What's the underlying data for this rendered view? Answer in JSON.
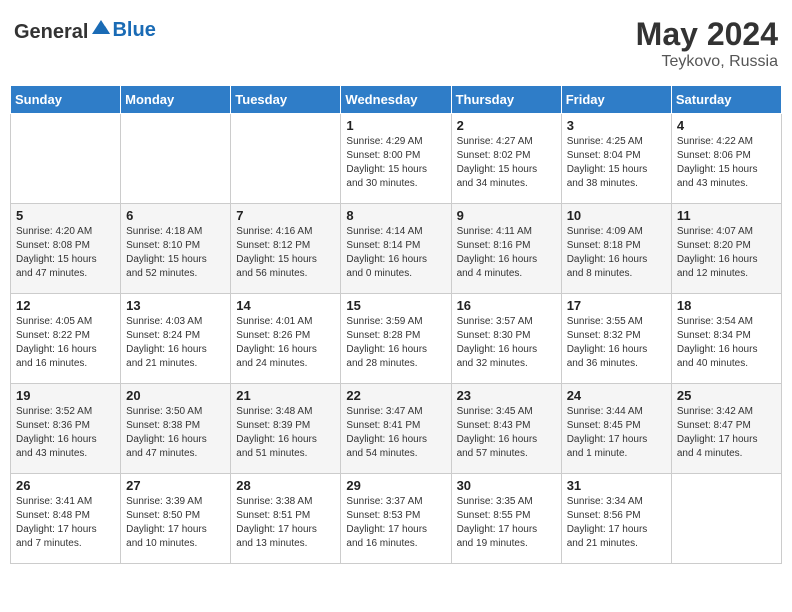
{
  "header": {
    "logo_general": "General",
    "logo_blue": "Blue",
    "month_year": "May 2024",
    "location": "Teykovo, Russia"
  },
  "days_of_week": [
    "Sunday",
    "Monday",
    "Tuesday",
    "Wednesday",
    "Thursday",
    "Friday",
    "Saturday"
  ],
  "weeks": [
    [
      {
        "day": "",
        "info": ""
      },
      {
        "day": "",
        "info": ""
      },
      {
        "day": "",
        "info": ""
      },
      {
        "day": "1",
        "info": "Sunrise: 4:29 AM\nSunset: 8:00 PM\nDaylight: 15 hours\nand 30 minutes."
      },
      {
        "day": "2",
        "info": "Sunrise: 4:27 AM\nSunset: 8:02 PM\nDaylight: 15 hours\nand 34 minutes."
      },
      {
        "day": "3",
        "info": "Sunrise: 4:25 AM\nSunset: 8:04 PM\nDaylight: 15 hours\nand 38 minutes."
      },
      {
        "day": "4",
        "info": "Sunrise: 4:22 AM\nSunset: 8:06 PM\nDaylight: 15 hours\nand 43 minutes."
      }
    ],
    [
      {
        "day": "5",
        "info": "Sunrise: 4:20 AM\nSunset: 8:08 PM\nDaylight: 15 hours\nand 47 minutes."
      },
      {
        "day": "6",
        "info": "Sunrise: 4:18 AM\nSunset: 8:10 PM\nDaylight: 15 hours\nand 52 minutes."
      },
      {
        "day": "7",
        "info": "Sunrise: 4:16 AM\nSunset: 8:12 PM\nDaylight: 15 hours\nand 56 minutes."
      },
      {
        "day": "8",
        "info": "Sunrise: 4:14 AM\nSunset: 8:14 PM\nDaylight: 16 hours\nand 0 minutes."
      },
      {
        "day": "9",
        "info": "Sunrise: 4:11 AM\nSunset: 8:16 PM\nDaylight: 16 hours\nand 4 minutes."
      },
      {
        "day": "10",
        "info": "Sunrise: 4:09 AM\nSunset: 8:18 PM\nDaylight: 16 hours\nand 8 minutes."
      },
      {
        "day": "11",
        "info": "Sunrise: 4:07 AM\nSunset: 8:20 PM\nDaylight: 16 hours\nand 12 minutes."
      }
    ],
    [
      {
        "day": "12",
        "info": "Sunrise: 4:05 AM\nSunset: 8:22 PM\nDaylight: 16 hours\nand 16 minutes."
      },
      {
        "day": "13",
        "info": "Sunrise: 4:03 AM\nSunset: 8:24 PM\nDaylight: 16 hours\nand 21 minutes."
      },
      {
        "day": "14",
        "info": "Sunrise: 4:01 AM\nSunset: 8:26 PM\nDaylight: 16 hours\nand 24 minutes."
      },
      {
        "day": "15",
        "info": "Sunrise: 3:59 AM\nSunset: 8:28 PM\nDaylight: 16 hours\nand 28 minutes."
      },
      {
        "day": "16",
        "info": "Sunrise: 3:57 AM\nSunset: 8:30 PM\nDaylight: 16 hours\nand 32 minutes."
      },
      {
        "day": "17",
        "info": "Sunrise: 3:55 AM\nSunset: 8:32 PM\nDaylight: 16 hours\nand 36 minutes."
      },
      {
        "day": "18",
        "info": "Sunrise: 3:54 AM\nSunset: 8:34 PM\nDaylight: 16 hours\nand 40 minutes."
      }
    ],
    [
      {
        "day": "19",
        "info": "Sunrise: 3:52 AM\nSunset: 8:36 PM\nDaylight: 16 hours\nand 43 minutes."
      },
      {
        "day": "20",
        "info": "Sunrise: 3:50 AM\nSunset: 8:38 PM\nDaylight: 16 hours\nand 47 minutes."
      },
      {
        "day": "21",
        "info": "Sunrise: 3:48 AM\nSunset: 8:39 PM\nDaylight: 16 hours\nand 51 minutes."
      },
      {
        "day": "22",
        "info": "Sunrise: 3:47 AM\nSunset: 8:41 PM\nDaylight: 16 hours\nand 54 minutes."
      },
      {
        "day": "23",
        "info": "Sunrise: 3:45 AM\nSunset: 8:43 PM\nDaylight: 16 hours\nand 57 minutes."
      },
      {
        "day": "24",
        "info": "Sunrise: 3:44 AM\nSunset: 8:45 PM\nDaylight: 17 hours\nand 1 minute."
      },
      {
        "day": "25",
        "info": "Sunrise: 3:42 AM\nSunset: 8:47 PM\nDaylight: 17 hours\nand 4 minutes."
      }
    ],
    [
      {
        "day": "26",
        "info": "Sunrise: 3:41 AM\nSunset: 8:48 PM\nDaylight: 17 hours\nand 7 minutes."
      },
      {
        "day": "27",
        "info": "Sunrise: 3:39 AM\nSunset: 8:50 PM\nDaylight: 17 hours\nand 10 minutes."
      },
      {
        "day": "28",
        "info": "Sunrise: 3:38 AM\nSunset: 8:51 PM\nDaylight: 17 hours\nand 13 minutes."
      },
      {
        "day": "29",
        "info": "Sunrise: 3:37 AM\nSunset: 8:53 PM\nDaylight: 17 hours\nand 16 minutes."
      },
      {
        "day": "30",
        "info": "Sunrise: 3:35 AM\nSunset: 8:55 PM\nDaylight: 17 hours\nand 19 minutes."
      },
      {
        "day": "31",
        "info": "Sunrise: 3:34 AM\nSunset: 8:56 PM\nDaylight: 17 hours\nand 21 minutes."
      },
      {
        "day": "",
        "info": ""
      }
    ]
  ]
}
